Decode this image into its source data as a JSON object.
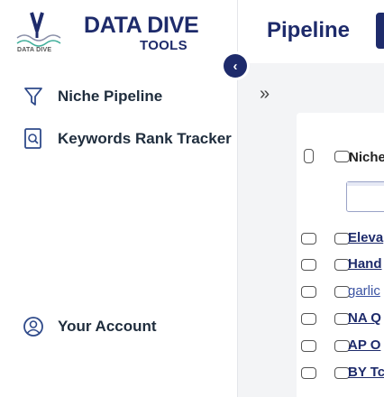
{
  "brand": {
    "mark_text": "DATA DIVE",
    "title": "DATA DIVE",
    "subtitle": "TOOLS"
  },
  "sidebar": {
    "items": [
      {
        "label": "Niche Pipeline",
        "icon": "filter-icon"
      },
      {
        "label": "Keywords Rank Tracker",
        "icon": "search-document-icon"
      },
      {
        "label": "Your Account",
        "icon": "user-circle-icon"
      }
    ],
    "collapse_icon": "‹"
  },
  "main": {
    "title": "Pipeline",
    "expand_icon": "»",
    "table": {
      "column_header": "Niche",
      "rows": [
        {
          "name": "Eleva"
        },
        {
          "name": "Hand"
        },
        {
          "name": "garlic"
        },
        {
          "name": "NA Q"
        },
        {
          "name": "AP O"
        },
        {
          "name": "BY Tc"
        }
      ]
    }
  },
  "colors": {
    "brand_navy": "#1e2b6b",
    "link_blue": "#3b53a3",
    "panel_bg": "#f3f4f6"
  }
}
